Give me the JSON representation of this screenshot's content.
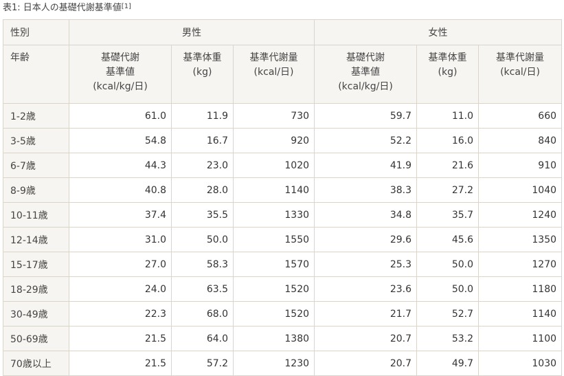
{
  "caption": {
    "text": "表1: 日本人の基礎代謝基準値",
    "ref": "[1]"
  },
  "header": {
    "sex_label": "性別",
    "male": "男性",
    "female": "女性",
    "age_label": "年齢",
    "cols": [
      {
        "l1": "基礎代謝",
        "l2": "基準値",
        "l3": "(kcal/kg/日)"
      },
      {
        "l1": "基準体重",
        "l2": "(kg)"
      },
      {
        "l1": "基準代謝量",
        "l2": "(kcal/日)"
      },
      {
        "l1": "基礎代謝",
        "l2": "基準値",
        "l3": "(kcal/kg/日)"
      },
      {
        "l1": "基準体重",
        "l2": "(kg)"
      },
      {
        "l1": "基準代謝量",
        "l2": "(kcal/日)"
      }
    ]
  },
  "rows": [
    [
      "1-2歳",
      "61.0",
      "11.9",
      "730",
      "59.7",
      "11.0",
      "660"
    ],
    [
      "3-5歳",
      "54.8",
      "16.7",
      "920",
      "52.2",
      "16.0",
      "840"
    ],
    [
      "6-7歳",
      "44.3",
      "23.0",
      "1020",
      "41.9",
      "21.6",
      "910"
    ],
    [
      "8-9歳",
      "40.8",
      "28.0",
      "1140",
      "38.3",
      "27.2",
      "1040"
    ],
    [
      "10-11歳",
      "37.4",
      "35.5",
      "1330",
      "34.8",
      "35.7",
      "1240"
    ],
    [
      "12-14歳",
      "31.0",
      "50.0",
      "1550",
      "29.6",
      "45.6",
      "1350"
    ],
    [
      "15-17歳",
      "27.0",
      "58.3",
      "1570",
      "25.3",
      "50.0",
      "1270"
    ],
    [
      "18-29歳",
      "24.0",
      "63.5",
      "1520",
      "23.6",
      "50.0",
      "1180"
    ],
    [
      "30-49歳",
      "22.3",
      "68.0",
      "1520",
      "21.7",
      "52.7",
      "1140"
    ],
    [
      "50-69歳",
      "21.5",
      "64.0",
      "1380",
      "20.7",
      "53.2",
      "1100"
    ],
    [
      "70歳以上",
      "21.5",
      "57.2",
      "1230",
      "20.7",
      "49.7",
      "1030"
    ]
  ]
}
